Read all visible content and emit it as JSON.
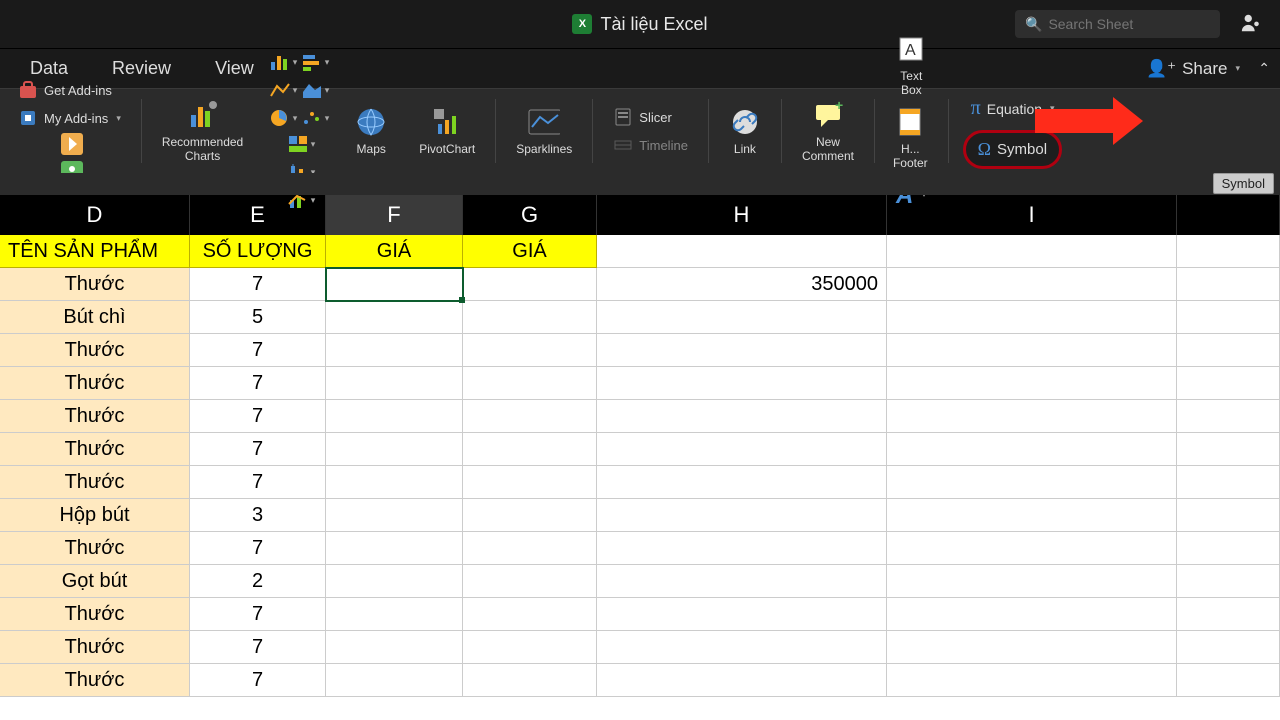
{
  "titlebar": {
    "document_name": "Tài liệu Excel",
    "search_placeholder": "Search Sheet"
  },
  "tabs": {
    "data": "Data",
    "review": "Review",
    "view": "View",
    "share": "Share"
  },
  "ribbon": {
    "get_addins": "Get Add-ins",
    "my_addins": "My Add-ins",
    "recommended_charts": "Recommended Charts",
    "maps": "Maps",
    "pivotchart": "PivotChart",
    "sparklines": "Sparklines",
    "slicer": "Slicer",
    "timeline": "Timeline",
    "link": "Link",
    "new_comment": "New Comment",
    "text_box": "Text Box",
    "header_footer": "H... Footer",
    "equation": "Equation",
    "symbol": "Symbol"
  },
  "tooltip": "Symbol",
  "columns": {
    "D": "D",
    "E": "E",
    "F": "F",
    "G": "G",
    "H": "H",
    "I": "I"
  },
  "headers": {
    "D": "TÊN SẢN PHẨM",
    "E": "SỐ LƯỢNG",
    "F": "GIÁ",
    "G": "GIÁ"
  },
  "rows": [
    {
      "D": "Thước",
      "E": "7",
      "H": "350000"
    },
    {
      "D": "Bút chì",
      "E": "5",
      "H": ""
    },
    {
      "D": "Thước",
      "E": "7",
      "H": ""
    },
    {
      "D": "Thước",
      "E": "7",
      "H": ""
    },
    {
      "D": "Thước",
      "E": "7",
      "H": ""
    },
    {
      "D": "Thước",
      "E": "7",
      "H": ""
    },
    {
      "D": "Thước",
      "E": "7",
      "H": ""
    },
    {
      "D": "Hộp bút",
      "E": "3",
      "H": ""
    },
    {
      "D": "Thước",
      "E": "7",
      "H": ""
    },
    {
      "D": "Gọt bút",
      "E": "2",
      "H": ""
    },
    {
      "D": "Thước",
      "E": "7",
      "H": ""
    },
    {
      "D": "Thước",
      "E": "7",
      "H": ""
    },
    {
      "D": "Thước",
      "E": "7",
      "H": ""
    }
  ]
}
